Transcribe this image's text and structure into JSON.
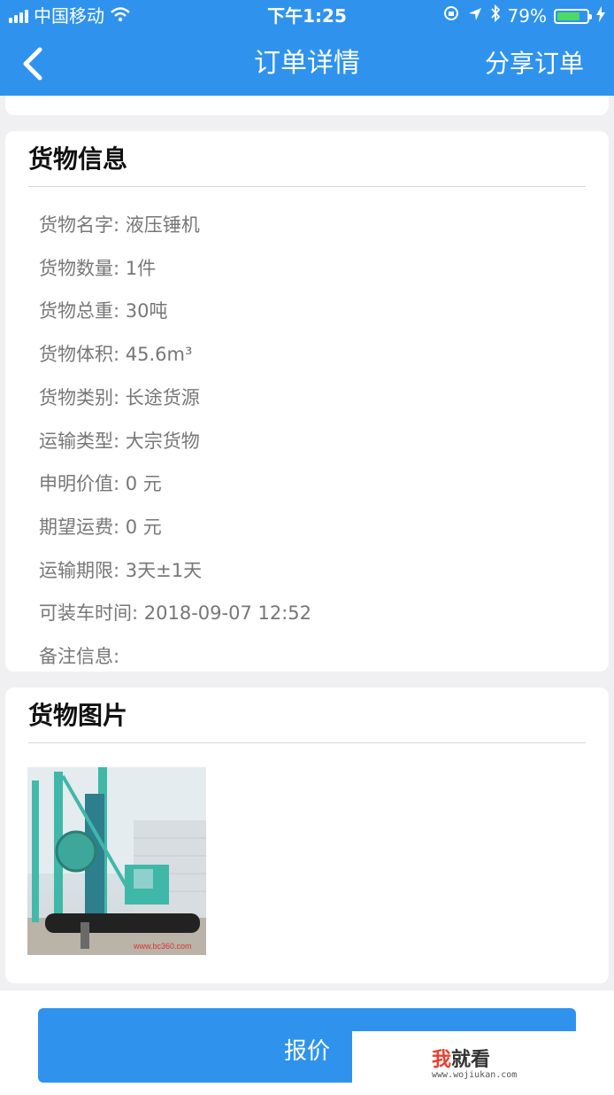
{
  "status_bar": {
    "carrier": "中国移动",
    "time": "下午1:25",
    "battery_percent": "79%",
    "battery_level": 0.79
  },
  "nav": {
    "title": "订单详情",
    "share_label": "分享订单"
  },
  "cargo_info": {
    "title": "货物信息",
    "rows": [
      {
        "label": "货物名字: ",
        "value": "液压锤机"
      },
      {
        "label": "货物数量: ",
        "value": "1件"
      },
      {
        "label": "货物总重: ",
        "value": "30吨"
      },
      {
        "label": "货物体积: ",
        "value": "45.6m³"
      },
      {
        "label": "货物类别: ",
        "value": "长途货源"
      },
      {
        "label": "运输类型: ",
        "value": "大宗货物"
      },
      {
        "label": "申明价值: ",
        "value": "0 元"
      },
      {
        "label": "期望运费: ",
        "value": "0 元"
      },
      {
        "label": "运输期限: ",
        "value": "3天±1天"
      },
      {
        "label": "可装车时间: ",
        "value": "2018-09-07 12:52"
      },
      {
        "label": "备注信息: ",
        "value": ""
      }
    ]
  },
  "cargo_photos": {
    "title": "货物图片",
    "photo_caption": "www.bc360.com"
  },
  "bottom": {
    "quote_label": "报价"
  },
  "watermark": {
    "logo_red": "我",
    "logo_rest": "就看",
    "url": "www.wojiukan.com"
  },
  "colors": {
    "header": "#2f93ee",
    "button": "#2f93ee",
    "battery": "#4cd964"
  }
}
